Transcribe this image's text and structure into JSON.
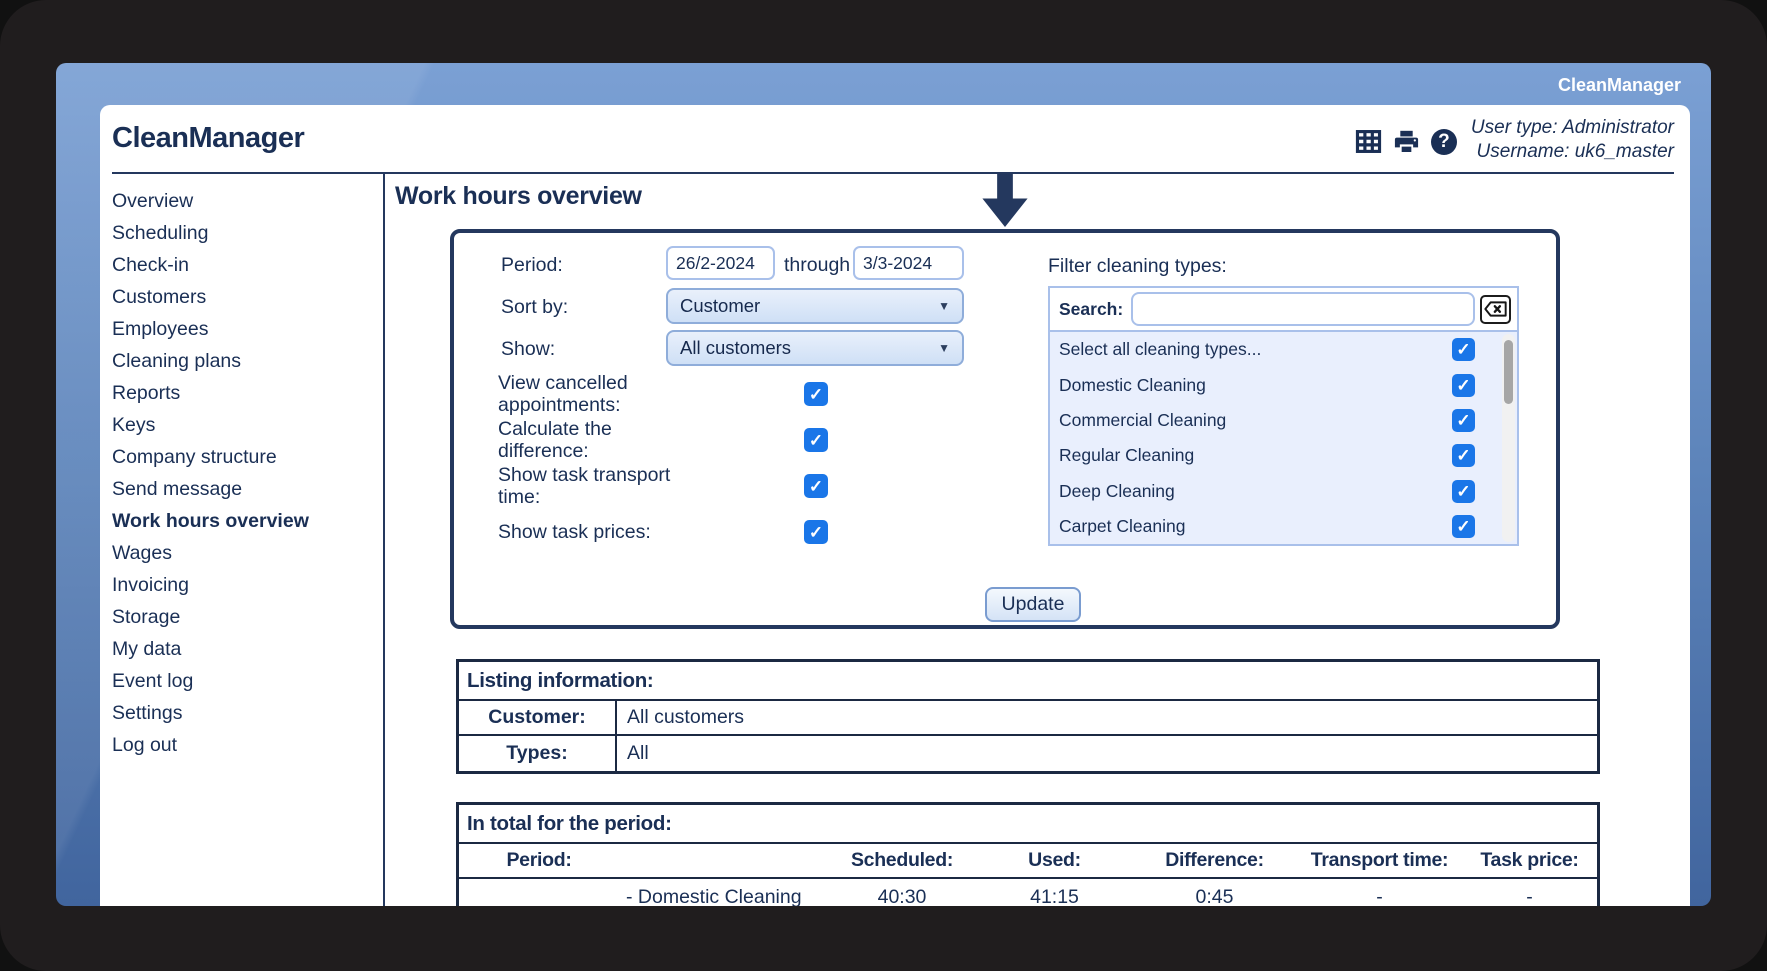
{
  "frame": {
    "brand_overlay": "CleanManager"
  },
  "header": {
    "app_title": "CleanManager",
    "icons": [
      "table-icon",
      "printer-icon",
      "help-icon"
    ],
    "user_type_label": "User type: Administrator",
    "username_label": "Username: uk6_master"
  },
  "sidebar": {
    "items": [
      {
        "label": "Overview",
        "active": false
      },
      {
        "label": "Scheduling",
        "active": false
      },
      {
        "label": "Check-in",
        "active": false
      },
      {
        "label": "Customers",
        "active": false
      },
      {
        "label": "Employees",
        "active": false
      },
      {
        "label": "Cleaning plans",
        "active": false
      },
      {
        "label": "Reports",
        "active": false
      },
      {
        "label": "Keys",
        "active": false
      },
      {
        "label": "Company structure",
        "active": false
      },
      {
        "label": "Send message",
        "active": false
      },
      {
        "label": "Work hours overview",
        "active": true
      },
      {
        "label": "Wages",
        "active": false
      },
      {
        "label": "Invoicing",
        "active": false
      },
      {
        "label": "Storage",
        "active": false
      },
      {
        "label": "My data",
        "active": false
      },
      {
        "label": "Event log",
        "active": false
      },
      {
        "label": "Settings",
        "active": false
      },
      {
        "label": "Log out",
        "active": false
      }
    ]
  },
  "main": {
    "page_title": "Work hours overview",
    "form": {
      "period_label": "Period:",
      "period_from": "26/2-2024",
      "through_label": "through",
      "period_to": "3/3-2024",
      "sort_by_label": "Sort by:",
      "sort_by_value": "Customer",
      "show_label": "Show:",
      "show_value": "All customers",
      "checkboxes": [
        {
          "label": "View cancelled appointments:",
          "checked": true
        },
        {
          "label": "Calculate the difference:",
          "checked": true
        },
        {
          "label": "Show task transport time:",
          "checked": true
        },
        {
          "label": "Show task prices:",
          "checked": true
        }
      ],
      "filter": {
        "title": "Filter cleaning types:",
        "search_label": "Search:",
        "search_value": "",
        "items": [
          {
            "label": "Select all cleaning types...",
            "checked": true
          },
          {
            "label": "Domestic Cleaning",
            "checked": true
          },
          {
            "label": "Commercial Cleaning",
            "checked": true
          },
          {
            "label": "Regular Cleaning",
            "checked": true
          },
          {
            "label": "Deep Cleaning",
            "checked": true
          },
          {
            "label": "Carpet Cleaning",
            "checked": true
          }
        ]
      },
      "update_button": "Update"
    },
    "listing_info": {
      "title": "Listing information:",
      "rows": [
        {
          "label": "Customer:",
          "value": "All customers"
        },
        {
          "label": "Types:",
          "value": "All"
        }
      ]
    },
    "totals": {
      "title": "In total for the period:",
      "columns": [
        "Period:",
        "",
        "Scheduled:",
        "Used:",
        "Difference:",
        "Transport time:",
        "Task price:"
      ],
      "rows": [
        {
          "period": "",
          "name": "- Domestic Cleaning",
          "scheduled": "40:30",
          "used": "41:15",
          "difference": "0:45",
          "transport_time": "-",
          "task_price": "-"
        }
      ]
    }
  },
  "colors": {
    "navy_text": "#1a2f55",
    "panel_border": "#24385e",
    "table_border": "#1b2942",
    "checkbox_blue": "#1a76e8",
    "list_background": "#e9effd",
    "background_blue_top": "#7ba0d4",
    "background_blue_bottom": "#41659e"
  }
}
